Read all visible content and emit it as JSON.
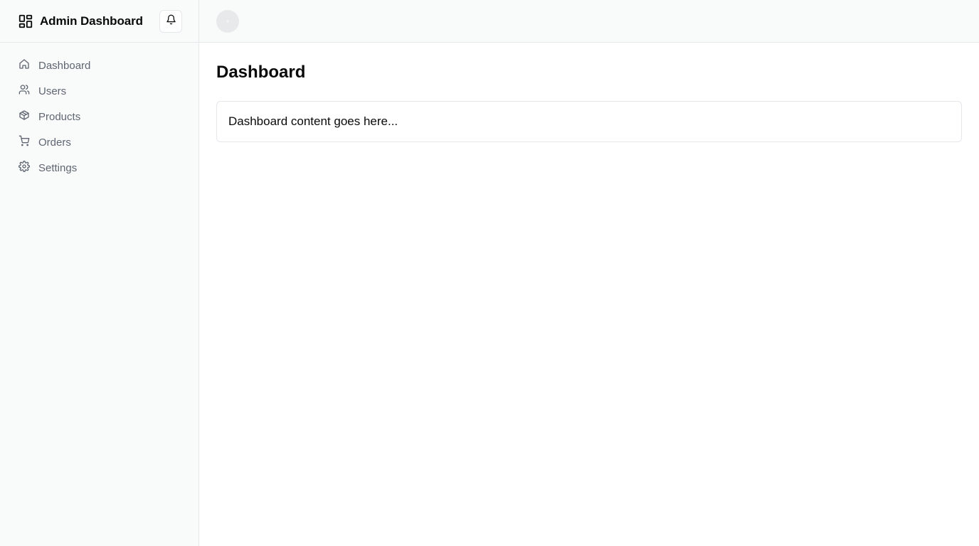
{
  "sidebar": {
    "brand": {
      "title": "Admin Dashboard",
      "icon": "layout-grid-icon"
    },
    "notifications": {
      "icon": "bell-icon"
    },
    "items": [
      {
        "label": "Dashboard",
        "icon": "home-icon"
      },
      {
        "label": "Users",
        "icon": "users-icon"
      },
      {
        "label": "Products",
        "icon": "box-icon"
      },
      {
        "label": "Orders",
        "icon": "cart-icon"
      },
      {
        "label": "Settings",
        "icon": "gear-icon"
      }
    ]
  },
  "main": {
    "page_title": "Dashboard",
    "card_text": "Dashboard content goes here..."
  },
  "colors": {
    "sidebar_bg": "#f9fafa",
    "border": "#e5e7eb",
    "nav_text": "#5f6672",
    "text": "#0a0a0a"
  }
}
